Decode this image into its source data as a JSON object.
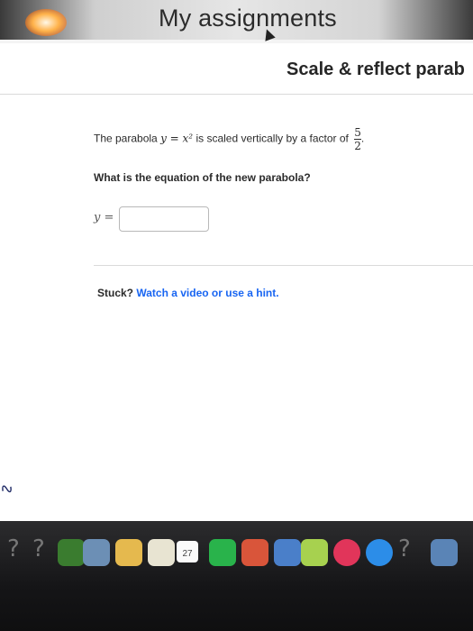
{
  "header": {
    "app_title": "My assignments"
  },
  "exercise": {
    "title": "Scale & reflect parab",
    "problem_prefix": "The parabola ",
    "problem_math": "y = x²",
    "problem_middle": " is scaled vertically by a factor of ",
    "factor_numerator": "5",
    "factor_denominator": "2",
    "problem_suffix": ".",
    "question": "What is the equation of the new parabola?",
    "answer_label": "y =",
    "answer_value": "",
    "hint_prefix": "Stuck? ",
    "hint_link": "Watch a video or use a hint."
  },
  "dock": {
    "calendar_day": "27",
    "icons": [
      "finder-icon",
      "notes-icon",
      "calendar-icon",
      "messages-icon",
      "facetime-icon",
      "keynote-icon",
      "photos-icon",
      "numbers-icon",
      "music-icon",
      "app-store-icon",
      "help-icon",
      "preview-icon"
    ]
  },
  "colors": {
    "link": "#1865f2",
    "text": "#2b2b2b"
  }
}
